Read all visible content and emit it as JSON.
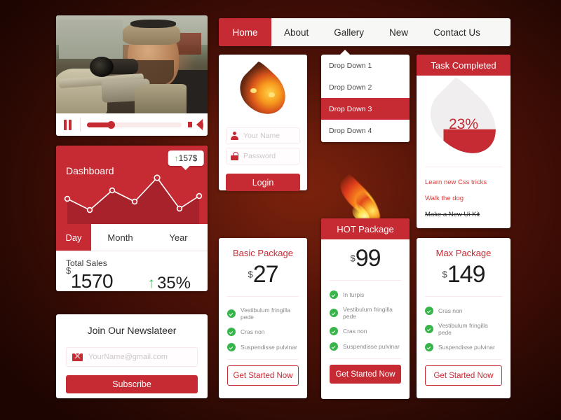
{
  "theme": {
    "brand_red": "#C62A33",
    "green": "#38B44A",
    "background": "#4A1207"
  },
  "video": {
    "pause_icon": "pause-icon",
    "volume_icon": "speaker-icon",
    "progress_percent": 25
  },
  "dashboard": {
    "title": "Dashboard",
    "tooltip_arrow": "↑",
    "tooltip_value": "157$",
    "tabs": [
      {
        "label": "Day",
        "active": true
      },
      {
        "label": "Month",
        "active": false
      },
      {
        "label": "Year",
        "active": false
      }
    ],
    "total_sales_label": "Total Sales",
    "currency": "$",
    "total_sales_value": "1570",
    "change_arrow": "↑",
    "change_value": "35%",
    "chart_points": [
      18,
      52,
      30,
      48,
      8,
      62,
      38
    ]
  },
  "newsletter": {
    "title": "Join Our Newslateer",
    "email_icon": "envelope-icon",
    "email_placeholder": "YourName@gmail.com",
    "email_value": "",
    "subscribe_label": "Subscribe"
  },
  "navbar": {
    "items": [
      {
        "label": "Home",
        "active": true
      },
      {
        "label": "About",
        "active": false
      },
      {
        "label": "Gallery",
        "active": false
      },
      {
        "label": "New",
        "active": false
      },
      {
        "label": "Contact Us",
        "active": false
      }
    ]
  },
  "login": {
    "avatar_icon": "flame-avatar-icon",
    "username_icon": "user-icon",
    "username_placeholder": "Your Name",
    "username_value": "",
    "password_icon": "lock-icon",
    "password_placeholder": "Password",
    "password_value": "",
    "login_label": "Login"
  },
  "dropdown": {
    "items": [
      {
        "label": "Drop Down 1",
        "active": false
      },
      {
        "label": "Drop Down 2",
        "active": false
      },
      {
        "label": "Drop Down 3",
        "active": true
      },
      {
        "label": "Drop Down 4",
        "active": false
      }
    ]
  },
  "task": {
    "header": "Task Completed",
    "percent_label": "23%",
    "percent_value": 23,
    "items": [
      {
        "label": "Learn new Css tricks",
        "done": false
      },
      {
        "label": "Walk the dog",
        "done": false
      },
      {
        "label": "Make a New Ui Kit",
        "done": true
      }
    ]
  },
  "pricing": {
    "basic": {
      "title": "Basic Package",
      "currency": "$",
      "amount": "27",
      "features": [
        "Vestibulum fringilla pede",
        "Cras non",
        "Suspendisse pulvinar"
      ],
      "cta": "Get Started Now"
    },
    "hot": {
      "banner": "HOT Package",
      "currency": "$",
      "amount": "99",
      "features": [
        "In turpis",
        "Vestibulum fringilla pede",
        "Cras non",
        "Suspendisse pulvinar"
      ],
      "cta": "Get Started Now"
    },
    "max": {
      "title": "Max Package",
      "currency": "$",
      "amount": "149",
      "features": [
        "Cras non",
        "Vestibulum fringilla pede",
        "Suspendisse pulvinar"
      ],
      "cta": "Get Started Now"
    }
  }
}
